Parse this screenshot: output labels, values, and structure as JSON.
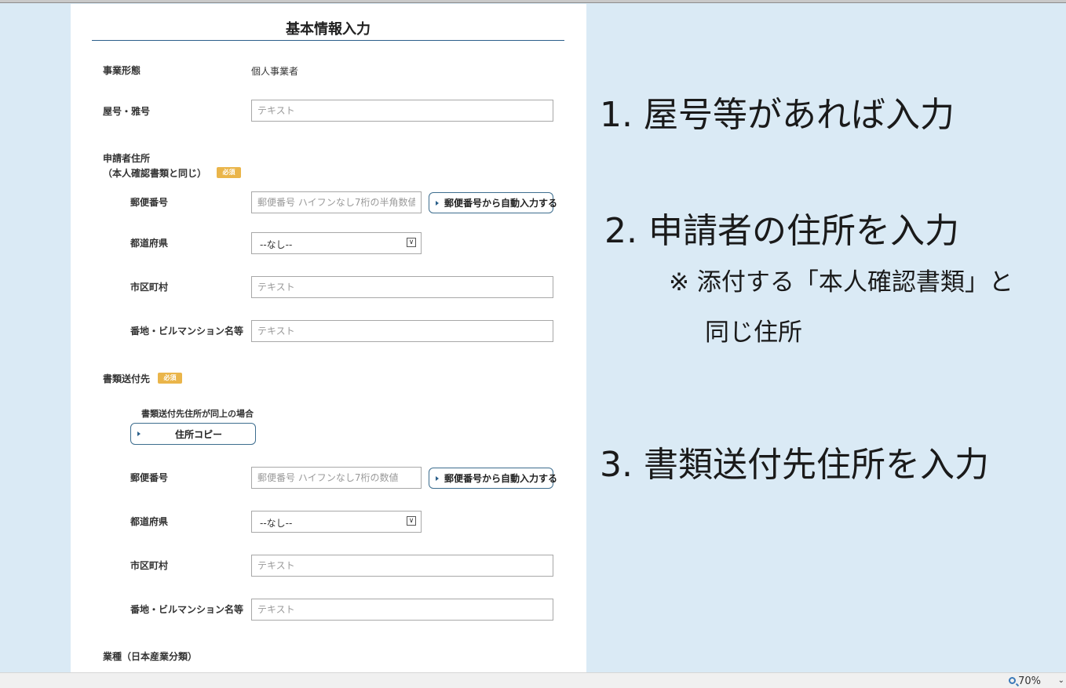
{
  "form": {
    "title": "基本情報入力",
    "business_type": {
      "label": "事業形態",
      "value": "個人事業者"
    },
    "trade_name": {
      "label": "屋号・雅号",
      "placeholder": "テキスト"
    },
    "applicant_address": {
      "label_line1": "申請者住所",
      "label_line2": "（本人確認書類と同じ）",
      "required_badge": "必須",
      "postal": {
        "label": "郵便番号",
        "placeholder": "郵便番号 ハイフンなし7桁の半角数値",
        "button": "郵便番号から自動入力する"
      },
      "prefecture": {
        "label": "都道府県",
        "selected": "--なし--"
      },
      "city": {
        "label": "市区町村",
        "placeholder": "テキスト"
      },
      "street": {
        "label": "番地・ビルマンション名等",
        "placeholder": "テキスト"
      }
    },
    "mailing_address": {
      "label": "書類送付先",
      "required_badge": "必須",
      "copy_note": "書類送付先住所が同上の場合",
      "copy_button": "住所コピー",
      "postal": {
        "label": "郵便番号",
        "placeholder": "郵便番号 ハイフンなし7桁の数値",
        "button": "郵便番号から自動入力する"
      },
      "prefecture": {
        "label": "都道府県",
        "selected": "--なし--"
      },
      "city": {
        "label": "市区町村",
        "placeholder": "テキスト"
      },
      "street": {
        "label": "番地・ビルマンション名等",
        "placeholder": "テキスト"
      }
    },
    "industry": {
      "label": "業種（日本産業分類）"
    }
  },
  "notes": {
    "step1": "1. 屋号等があれば入力",
    "step2": "2. 申請者の住所を入力",
    "step2_sub_line1": "※ 添付する「本人確認書類」と",
    "step2_sub_line2": "同じ住所",
    "step3": "3. 書類送付先住所を入力"
  },
  "status_bar": {
    "zoom": "70%",
    "zoom_icon": "magnifier-icon"
  },
  "colors": {
    "background": "#daeaf5",
    "accent": "#2b5f8a",
    "required_badge": "#eab54a"
  }
}
